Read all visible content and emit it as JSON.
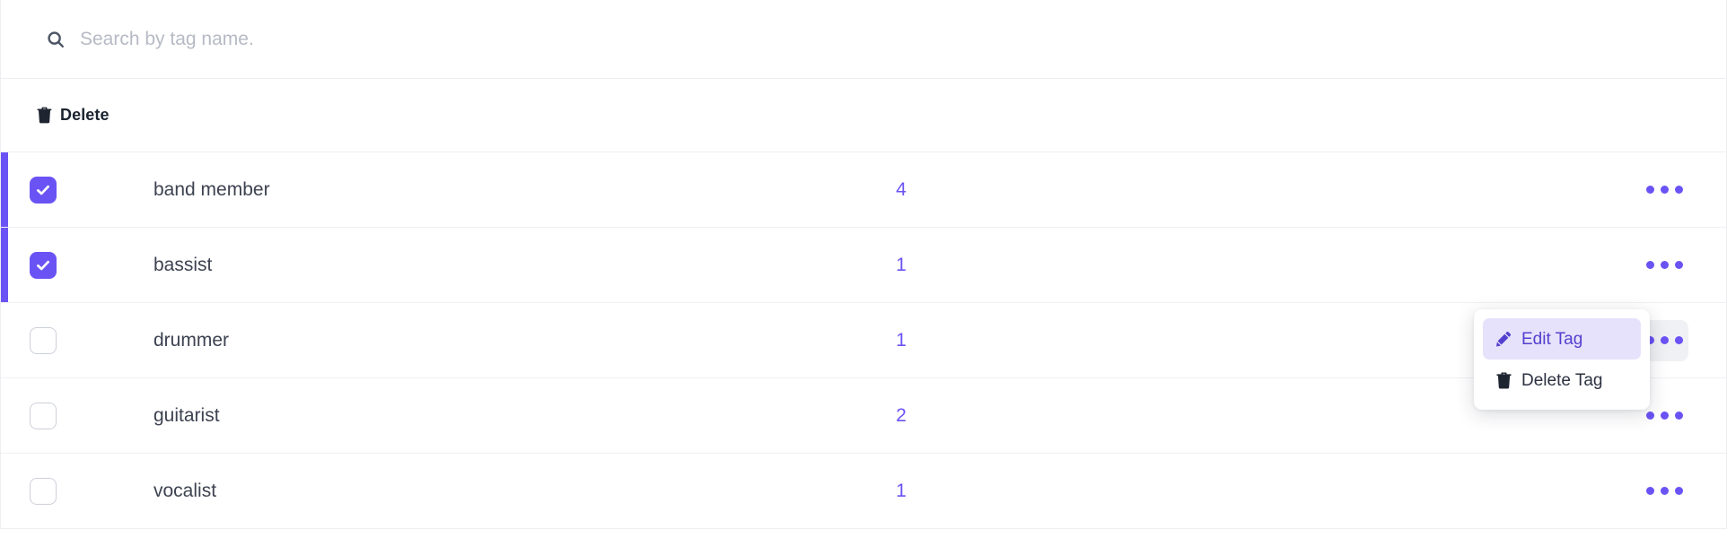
{
  "search": {
    "icon": "search-icon",
    "placeholder": "Search by tag name.",
    "value": ""
  },
  "toolbar": {
    "delete_label": "Delete",
    "delete_icon": "trash-icon"
  },
  "colors": {
    "accent_purple": "#6a53f4",
    "menu_highlight_bg": "#e7e2fb",
    "menu_highlight_text": "#5340cf",
    "row_border": "#eff0f3",
    "text_primary": "#3c4250",
    "placeholder": "#b6bac4"
  },
  "table": {
    "rows": [
      {
        "name": "band member",
        "count": "4",
        "selected": true,
        "menu_active": false
      },
      {
        "name": "bassist",
        "count": "1",
        "selected": true,
        "menu_active": false
      },
      {
        "name": "drummer",
        "count": "1",
        "selected": false,
        "menu_active": true
      },
      {
        "name": "guitarist",
        "count": "2",
        "selected": false,
        "menu_active": false
      },
      {
        "name": "vocalist",
        "count": "1",
        "selected": false,
        "menu_active": false
      }
    ]
  },
  "dropdown": {
    "visible": true,
    "anchor_row": "drummer",
    "items": [
      {
        "label": "Edit Tag",
        "icon": "pencil-icon",
        "highlighted": true
      },
      {
        "label": "Delete Tag",
        "icon": "trash-icon",
        "highlighted": false
      }
    ]
  }
}
